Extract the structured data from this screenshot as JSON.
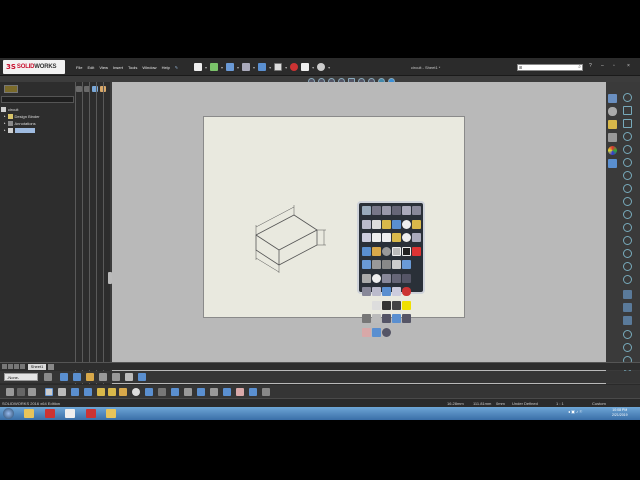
{
  "app": {
    "logo_ds": "3S",
    "logo_solid": "SOLID",
    "logo_works": "WORKS",
    "menu": [
      "File",
      "Edit",
      "View",
      "Insert",
      "Tools",
      "Window",
      "Help"
    ],
    "document_title": "circuit - Sheet1 *",
    "search_icon": "⊞",
    "window_controls": [
      "?",
      "–",
      "▫",
      "×"
    ]
  },
  "feature_tree": {
    "root": "circuit",
    "items": [
      "Design Binder",
      "Annotations"
    ],
    "sheet": ""
  },
  "sheet_tabs": {
    "active": "Sheet1"
  },
  "layer_select": {
    "value": "-None-"
  },
  "status_bar": {
    "product": "SOLIDWORKS 2016 x64 Edition",
    "x": "16.28mm",
    "y": "111.81mm",
    "z": "0mm",
    "state": "Under Defined",
    "scale": "1 : 1",
    "units": "Custom"
  },
  "taskbar": {
    "time": "10:08 PM",
    "date": "2/21/2019"
  },
  "colors": {
    "accent": "#c8102e",
    "sheet_bg": "#e9e9df",
    "graphics_bg": "#b9b9b9"
  },
  "icons": {
    "shortcut_box": [
      "sketch",
      "smart-dimension",
      "note",
      "balloon",
      "surface-finish",
      "datum",
      "table",
      "bom",
      "hole-table",
      "revision",
      "magnet",
      "weld",
      "hatch",
      "centermark",
      "centerline",
      "line",
      "circle",
      "arc",
      "rotate",
      "copy",
      "layer",
      "line-format",
      "color",
      "delete",
      "undo",
      "redo",
      "hide",
      "show",
      "model-items",
      "view",
      "cosmetic-thread",
      "properties",
      "dimxpert",
      "spline",
      "rectangle",
      "point",
      "datum-target",
      "weld-bead",
      "geometric-tolerance",
      "block",
      "scale",
      "color-yellow",
      "image",
      "pattern",
      "edit"
    ]
  }
}
